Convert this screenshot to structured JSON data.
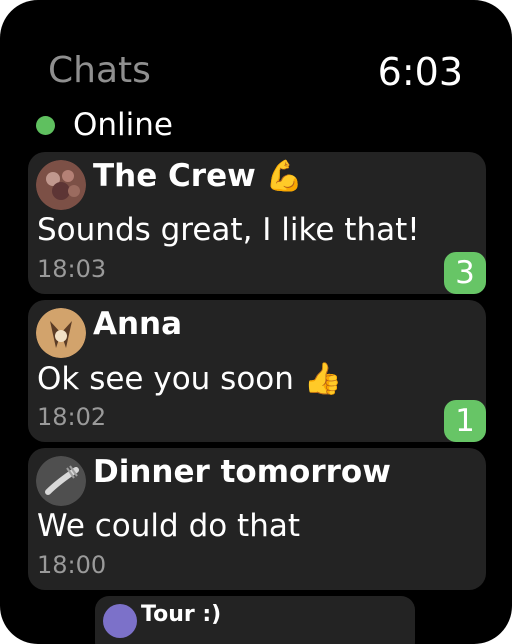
{
  "header": {
    "title": "Chats",
    "time": "6:03"
  },
  "status": {
    "label": "Online"
  },
  "chats": [
    {
      "name": "The Crew",
      "emoji": "💪",
      "message": "Sounds great, I like that!",
      "time": "18:03",
      "unread": "3"
    },
    {
      "name": "Anna",
      "message": "Ok see you soon 👍",
      "time": "18:02",
      "unread": "1"
    },
    {
      "name": "Dinner tomorrow",
      "message": "We could do that",
      "time": "18:00"
    },
    {
      "name": "Tour :)"
    }
  ],
  "colors": {
    "background": "#000000",
    "card": "#232323",
    "accent": "#67c566",
    "online": "#5fc05f",
    "muted": "#9a9a9a"
  },
  "icons": {
    "online_status": "online-dot-icon",
    "crew_emoji": "flexed-biceps-icon"
  }
}
